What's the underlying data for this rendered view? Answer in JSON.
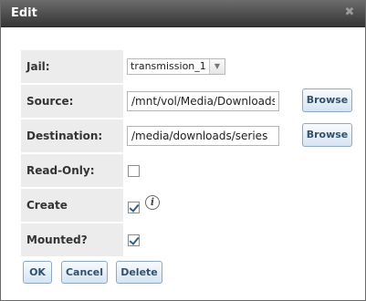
{
  "dialog": {
    "title": "Edit",
    "close_icon": "close-icon"
  },
  "form": {
    "jail": {
      "label": "Jail:",
      "selected": "transmission_1"
    },
    "source": {
      "label": "Source:",
      "value": "/mnt/vol/Media/Downloads/s",
      "browse_label": "Browse"
    },
    "destination": {
      "label": "Destination:",
      "value": "/media/downloads/series",
      "browse_label": "Browse"
    },
    "read_only": {
      "label": "Read-Only:",
      "checked": false
    },
    "create_directory": {
      "label": "Create directory:",
      "checked": true,
      "info_icon": "info-icon"
    },
    "mounted": {
      "label": "Mounted?",
      "checked": true
    }
  },
  "actions": {
    "ok_label": "OK",
    "cancel_label": "Cancel",
    "delete_label": "Delete"
  },
  "colors": {
    "titlebar": "#4a4a4a",
    "label_background": "#ececec",
    "button_text": "#33506b"
  }
}
